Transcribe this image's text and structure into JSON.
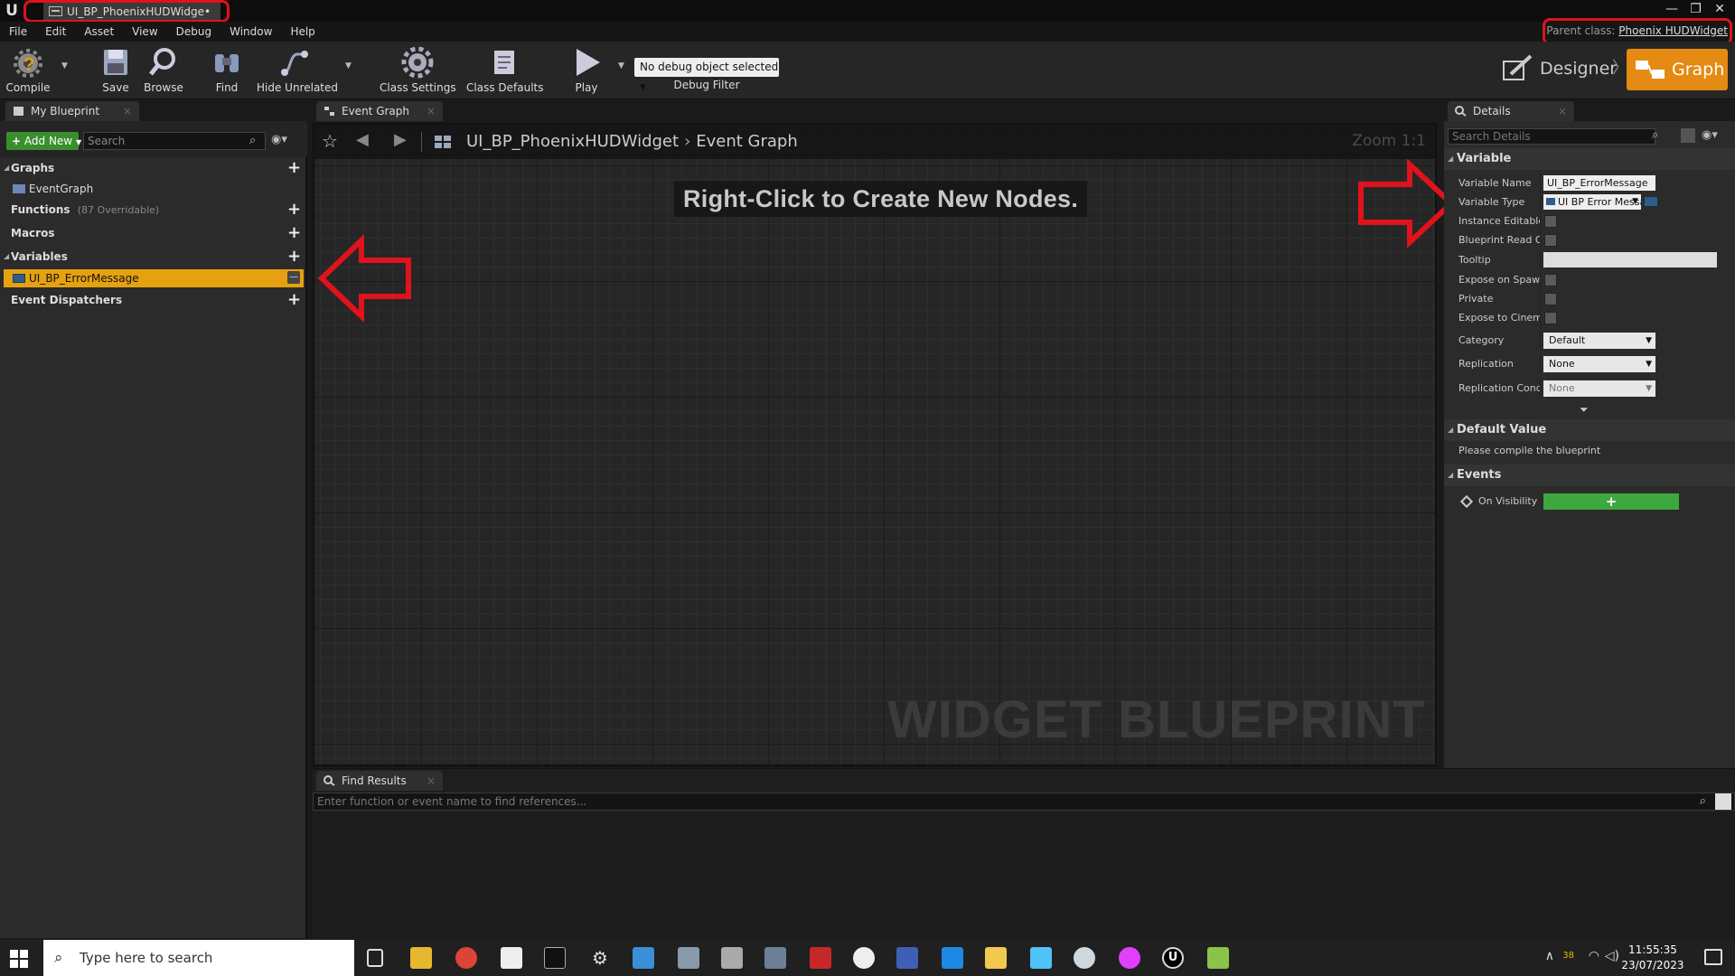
{
  "window": {
    "doc_tab_title": "UI_BP_PhoenixHUDWidge•",
    "controls": [
      "—",
      "❐",
      "✕"
    ]
  },
  "menu": {
    "items": [
      "File",
      "Edit",
      "Asset",
      "View",
      "Debug",
      "Window",
      "Help"
    ],
    "parent_class_label": "Parent class:",
    "parent_class_value": "Phoenix HUDWidget"
  },
  "toolbar": {
    "compile": "Compile",
    "save": "Save",
    "browse": "Browse",
    "find": "Find",
    "hide_unrelated": "Hide Unrelated",
    "class_settings": "Class Settings",
    "class_defaults": "Class Defaults",
    "play": "Play",
    "debug_object": "No debug object selected",
    "debug_filter": "Debug Filter",
    "designer": "Designer",
    "graph": "Graph"
  },
  "my_blueprint": {
    "tab_label": "My Blueprint",
    "add_new": "Add New",
    "search_placeholder": "Search",
    "graphs_label": "Graphs",
    "event_graph_item": "EventGraph",
    "functions_label": "Functions",
    "functions_sub": "(87 Overridable)",
    "macros_label": "Macros",
    "variables_label": "Variables",
    "variable_item": "UI_BP_ErrorMessage",
    "dispatchers_label": "Event Dispatchers"
  },
  "event_graph": {
    "tab_label": "Event Graph",
    "crumb_root": "UI_BP_PhoenixHUDWidget",
    "crumb_leaf": "Event Graph",
    "zoom": "Zoom 1:1",
    "hint": "Right-Click to Create New Nodes.",
    "watermark": "WIDGET BLUEPRINT"
  },
  "details": {
    "tab_label": "Details",
    "search_placeholder": "Search Details",
    "variable_section": "Variable",
    "var_name_label": "Variable Name",
    "var_name_value": "UI_BP_ErrorMessage",
    "var_type_label": "Variable Type",
    "var_type_value": "UI BP Error Message",
    "instance_editable": "Instance Editable",
    "bp_read_only": "Blueprint Read Only",
    "tooltip_label": "Tooltip",
    "expose_spawn": "Expose on Spawn",
    "private_label": "Private",
    "expose_cinematics": "Expose to Cinematics",
    "category_label": "Category",
    "category_value": "Default",
    "replication_label": "Replication",
    "replication_value": "None",
    "rep_condition_label": "Replication Condition",
    "rep_condition_value": "None",
    "default_value_section": "Default Value",
    "default_value_msg": "Please compile the blueprint",
    "events_section": "Events",
    "on_visibility_label": "On Visibility Changed",
    "add_symbol": "+"
  },
  "find_results": {
    "tab_label": "Find Results",
    "input_placeholder": "Enter function or event name to find references..."
  },
  "taskbar": {
    "search_placeholder": "Type here to search",
    "tray_temp": "38",
    "time": "11:55:35",
    "date": "23/07/2023"
  },
  "colors": {
    "accent_orange": "#e58a12",
    "selected_variable": "#e5a10f",
    "add_green": "#3a8e2e",
    "annotation_red": "#e0121c"
  }
}
